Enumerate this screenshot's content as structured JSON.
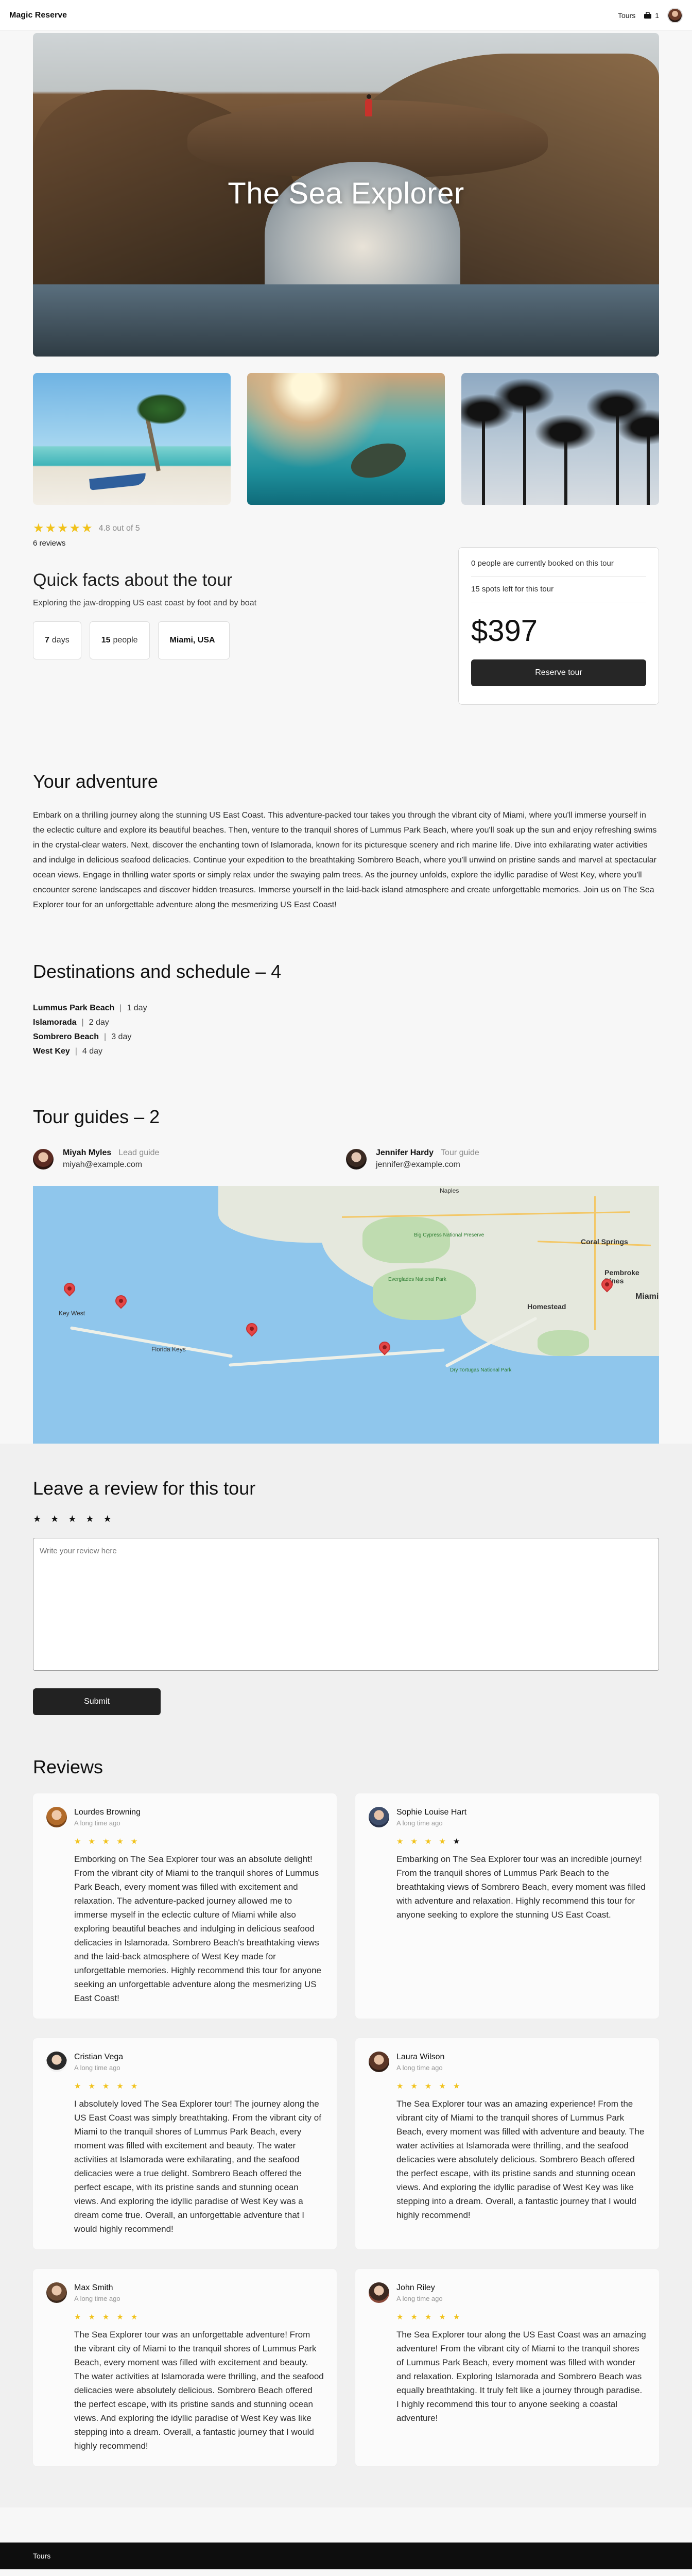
{
  "header": {
    "brand": "Magic Reserve",
    "tours_link": "Tours",
    "bookings_count": "1",
    "bookings_icon": "briefcase-icon"
  },
  "hero": {
    "title": "The Sea Explorer"
  },
  "rating": {
    "value_text": "4.8 out of 5",
    "reviews_count": "6 reviews",
    "stars": 5
  },
  "quick_facts": {
    "title": "Quick facts about the tour",
    "subtitle": "Exploring the jaw-dropping US east coast by foot and by boat",
    "duration_value": "7",
    "duration_unit": "days",
    "people_value": "15",
    "people_unit": "people",
    "location": "Miami, USA"
  },
  "booking": {
    "booked_text": "0 people are currently booked on this tour",
    "spots_text": "15 spots left for this tour",
    "price": "$397",
    "reserve_label": "Reserve tour"
  },
  "adventure": {
    "title": "Your adventure",
    "text": "Embark on a thrilling journey along the stunning US East Coast. This adventure-packed tour takes you through the vibrant city of Miami, where you'll immerse yourself in the eclectic culture and explore its beautiful beaches. Then, venture to the tranquil shores of Lummus Park Beach, where you'll soak up the sun and enjoy refreshing swims in the crystal-clear waters. Next, discover the enchanting town of Islamorada, known for its picturesque scenery and rich marine life. Dive into exhilarating water activities and indulge in delicious seafood delicacies. Continue your expedition to the breathtaking Sombrero Beach, where you'll unwind on pristine sands and marvel at spectacular ocean views. Engage in thrilling water sports or simply relax under the swaying palm trees. As the journey unfolds, explore the idyllic paradise of West Key, where you'll encounter serene landscapes and discover hidden treasures. Immerse yourself in the laid-back island atmosphere and create unforgettable memories. Join us on The Sea Explorer tour for an unforgettable adventure along the mesmerizing US East Coast!"
  },
  "schedule": {
    "title": "Destinations and schedule – 4",
    "items": [
      {
        "place": "Lummus Park Beach",
        "day": "1 day"
      },
      {
        "place": "Islamorada",
        "day": "2 day"
      },
      {
        "place": "Sombrero Beach",
        "day": "3 day"
      },
      {
        "place": "West Key",
        "day": "4 day"
      }
    ]
  },
  "guides": {
    "title": "Tour guides – 2",
    "items": [
      {
        "name": "Miyah Myles",
        "role": "Lead guide",
        "email": "miyah@example.com"
      },
      {
        "name": "Jennifer Hardy",
        "role": "Tour guide",
        "email": "jennifer@example.com"
      }
    ]
  },
  "map": {
    "labels": {
      "miami": "Miami",
      "homestead": "Homestead",
      "coral_springs": "Coral Springs",
      "pembroke_pines": "Pembroke Pines",
      "naples": "Naples",
      "everglades_np": "Everglades National Park",
      "big_cypress": "Big Cypress National Preserve",
      "dry_tortugas": "Dry Tortugas National Park",
      "florida_keys": "Florida Keys",
      "key_west": "Key West"
    }
  },
  "review_form": {
    "title": "Leave a review for this tour",
    "placeholder": "Write your review here",
    "submit_label": "Submit"
  },
  "reviews": {
    "title": "Reviews",
    "items": [
      {
        "name": "Lourdes Browning",
        "time": "A long time ago",
        "stars": 5,
        "text": "Emborking on The Sea Explorer tour was an absolute delight! From the vibrant city of Miami to the tranquil shores of Lummus Park Beach, every moment was filled with excitement and relaxation. The adventure-packed journey allowed me to immerse myself in the eclectic culture of Miami while also exploring beautiful beaches and indulging in delicious seafood delicacies in Islamorada. Sombrero Beach's breathtaking views and the laid-back atmosphere of West Key made for unforgettable memories. Highly recommend this tour for anyone seeking an unforgettable adventure along the mesmerizing US East Coast!"
      },
      {
        "name": "Sophie Louise Hart",
        "time": "A long time ago",
        "stars": 4,
        "text": "Embarking on The Sea Explorer tour was an incredible journey! From the tranquil shores of Lummus Park Beach to the breathtaking views of Sombrero Beach, every moment was filled with adventure and relaxation. Highly recommend this tour for anyone seeking to explore the stunning US East Coast."
      },
      {
        "name": "Cristian Vega",
        "time": "A long time ago",
        "stars": 5,
        "text": "I absolutely loved The Sea Explorer tour! The journey along the US East Coast was simply breathtaking. From the vibrant city of Miami to the tranquil shores of Lummus Park Beach, every moment was filled with excitement and beauty. The water activities at Islamorada were exhilarating, and the seafood delicacies were a true delight. Sombrero Beach offered the perfect escape, with its pristine sands and stunning ocean views. And exploring the idyllic paradise of West Key was a dream come true. Overall, an unforgettable adventure that I would highly recommend!"
      },
      {
        "name": "Laura Wilson",
        "time": "A long time ago",
        "stars": 5,
        "text": "The Sea Explorer tour was an amazing experience! From the vibrant city of Miami to the tranquil shores of Lummus Park Beach, every moment was filled with adventure and beauty. The water activities at Islamorada were thrilling, and the seafood delicacies were absolutely delicious. Sombrero Beach offered the perfect escape, with its pristine sands and stunning ocean views. And exploring the idyllic paradise of West Key was like stepping into a dream. Overall, a fantastic journey that I would highly recommend!"
      },
      {
        "name": "Max Smith",
        "time": "A long time ago",
        "stars": 5,
        "text": "The Sea Explorer tour was an unforgettable adventure! From the vibrant city of Miami to the tranquil shores of Lummus Park Beach, every moment was filled with excitement and beauty. The water activities at Islamorada were thrilling, and the seafood delicacies were absolutely delicious. Sombrero Beach offered the perfect escape, with its pristine sands and stunning ocean views. And exploring the idyllic paradise of West Key was like stepping into a dream. Overall, a fantastic journey that I would highly recommend!"
      },
      {
        "name": "John Riley",
        "time": "A long time ago",
        "stars": 5,
        "text": "The Sea Explorer tour along the US East Coast was an amazing adventure! From the vibrant city of Miami to the tranquil shores of Lummus Park Beach, every moment was filled with wonder and relaxation. Exploring Islamorada and Sombrero Beach was equally breathtaking. It truly felt like a journey through paradise. I highly recommend this tour to anyone seeking a coastal adventure!"
      }
    ]
  },
  "footer": {
    "link": "Tours"
  },
  "colors": {
    "accent_star": "#f1c21b",
    "dark_button": "#262626",
    "map_water": "#8fc6ec",
    "pin": "#e54646"
  }
}
